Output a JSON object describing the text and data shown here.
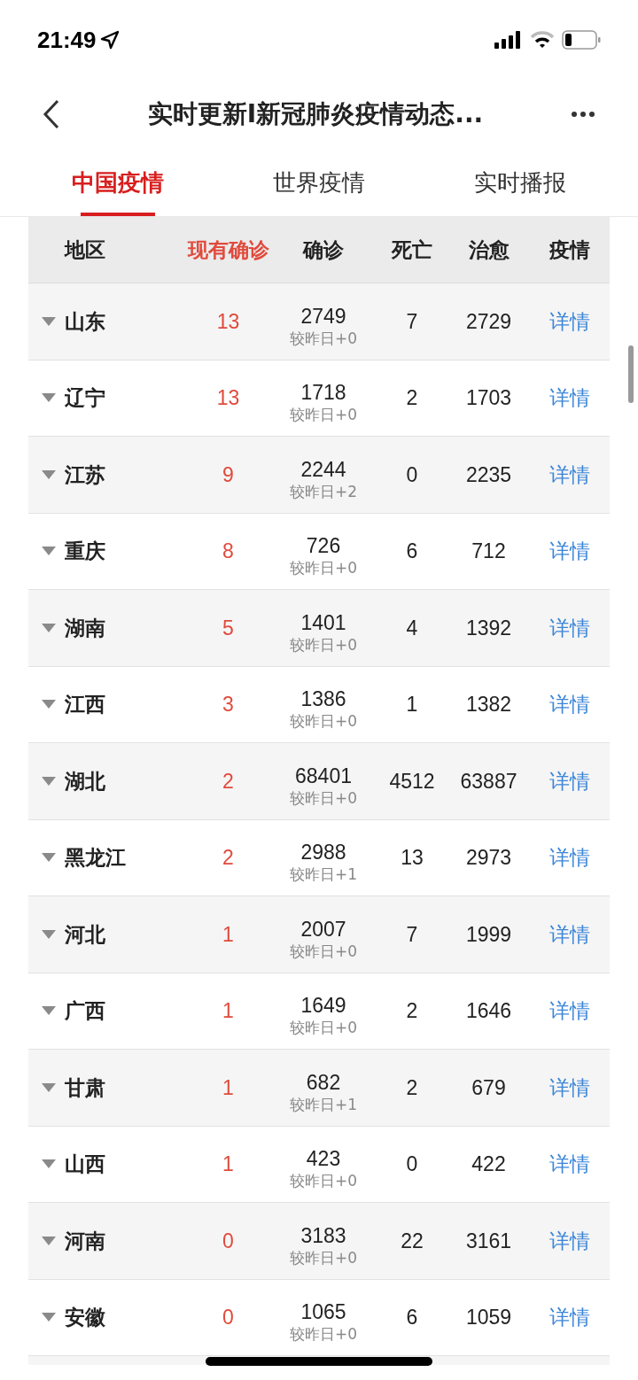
{
  "status_bar": {
    "time": "21:49"
  },
  "header": {
    "title": "实时更新I新冠肺炎疫情动态..."
  },
  "tabs": [
    {
      "label": "中国疫情",
      "selected": true
    },
    {
      "label": "世界疫情",
      "selected": false
    },
    {
      "label": "实时播报",
      "selected": false
    }
  ],
  "table": {
    "columns": [
      {
        "label": "地区",
        "sorted": false
      },
      {
        "label": "现有确诊",
        "sorted": true
      },
      {
        "label": "确诊",
        "sorted": false
      },
      {
        "label": "死亡",
        "sorted": false
      },
      {
        "label": "治愈",
        "sorted": false
      },
      {
        "label": "疫情",
        "sorted": false
      }
    ],
    "rows": [
      {
        "region": "山东",
        "current": "13",
        "confirmed": "2749",
        "change": "较昨日+0",
        "deaths": "7",
        "cured": "2729",
        "detail": "详情"
      },
      {
        "region": "辽宁",
        "current": "13",
        "confirmed": "1718",
        "change": "较昨日+0",
        "deaths": "2",
        "cured": "1703",
        "detail": "详情"
      },
      {
        "region": "江苏",
        "current": "9",
        "confirmed": "2244",
        "change": "较昨日+2",
        "deaths": "0",
        "cured": "2235",
        "detail": "详情"
      },
      {
        "region": "重庆",
        "current": "8",
        "confirmed": "726",
        "change": "较昨日+0",
        "deaths": "6",
        "cured": "712",
        "detail": "详情"
      },
      {
        "region": "湖南",
        "current": "5",
        "confirmed": "1401",
        "change": "较昨日+0",
        "deaths": "4",
        "cured": "1392",
        "detail": "详情"
      },
      {
        "region": "江西",
        "current": "3",
        "confirmed": "1386",
        "change": "较昨日+0",
        "deaths": "1",
        "cured": "1382",
        "detail": "详情"
      },
      {
        "region": "湖北",
        "current": "2",
        "confirmed": "68401",
        "change": "较昨日+0",
        "deaths": "4512",
        "cured": "63887",
        "detail": "详情"
      },
      {
        "region": "黑龙江",
        "current": "2",
        "confirmed": "2988",
        "change": "较昨日+1",
        "deaths": "13",
        "cured": "2973",
        "detail": "详情"
      },
      {
        "region": "河北",
        "current": "1",
        "confirmed": "2007",
        "change": "较昨日+0",
        "deaths": "7",
        "cured": "1999",
        "detail": "详情"
      },
      {
        "region": "广西",
        "current": "1",
        "confirmed": "1649",
        "change": "较昨日+0",
        "deaths": "2",
        "cured": "1646",
        "detail": "详情"
      },
      {
        "region": "甘肃",
        "current": "1",
        "confirmed": "682",
        "change": "较昨日+1",
        "deaths": "2",
        "cured": "679",
        "detail": "详情"
      },
      {
        "region": "山西",
        "current": "1",
        "confirmed": "423",
        "change": "较昨日+0",
        "deaths": "0",
        "cured": "422",
        "detail": "详情"
      },
      {
        "region": "河南",
        "current": "0",
        "confirmed": "3183",
        "change": "较昨日+0",
        "deaths": "22",
        "cured": "3161",
        "detail": "详情"
      },
      {
        "region": "安徽",
        "current": "0",
        "confirmed": "1065",
        "change": "较昨日+0",
        "deaths": "6",
        "cured": "1059",
        "detail": "详情"
      }
    ]
  }
}
